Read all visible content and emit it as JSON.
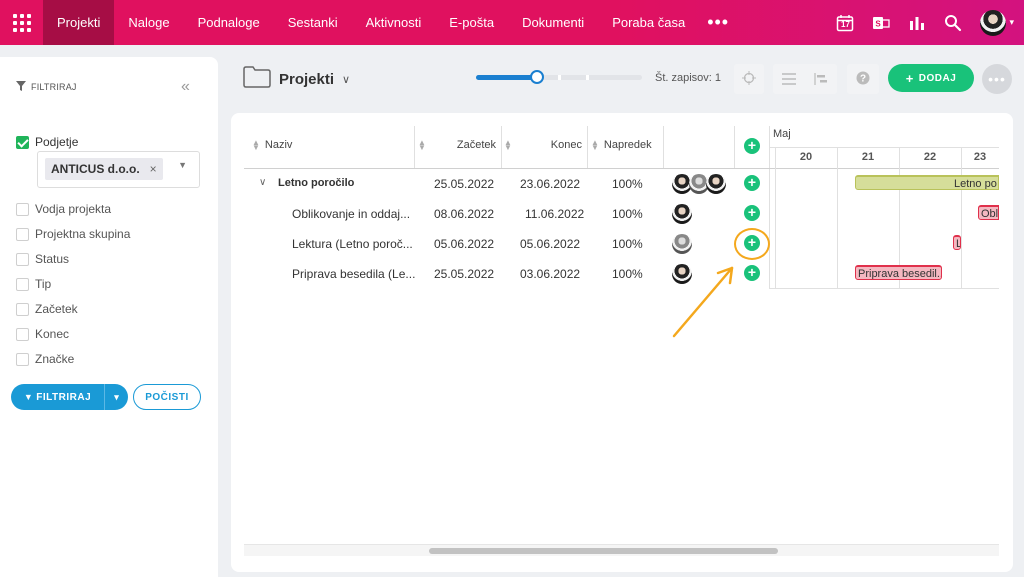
{
  "nav": {
    "items": [
      {
        "label": "Projekti",
        "active": true
      },
      {
        "label": "Naloge",
        "active": false
      },
      {
        "label": "Podnaloge",
        "active": false
      },
      {
        "label": "Sestanki",
        "active": false
      },
      {
        "label": "Aktivnosti",
        "active": false
      },
      {
        "label": "E-pošta",
        "active": false
      },
      {
        "label": "Dokumenti",
        "active": false
      },
      {
        "label": "Poraba časa",
        "active": false
      }
    ],
    "more": "•••",
    "calendar_day": "17",
    "icons": [
      "apps-grid-icon",
      "calendar-icon",
      "outlook-icon",
      "bar-chart-icon",
      "search-icon",
      "user-avatar"
    ]
  },
  "sidebar": {
    "title": "FILTRIRAJ",
    "collapse": "«",
    "client_label": "Podjetje",
    "client_tag": "ANTICUS d.o.o.",
    "client_tag_remove": "×",
    "filters": [
      "Vodja projekta",
      "Projektna skupina",
      "Status",
      "Tip",
      "Začetek",
      "Konec",
      "Značke"
    ],
    "filter_button": "FILTRIRAJ",
    "clear_button": "POČISTI"
  },
  "toolbar": {
    "title": "Projekti",
    "record_count": "Št. zapisov: 1",
    "add_button": "DODAJ",
    "more": "•••",
    "zoom_level": 0.37
  },
  "table": {
    "columns": [
      "Naziv",
      "Začetek",
      "Konec",
      "Napredek"
    ],
    "rows": [
      {
        "name": "Letno poročilo",
        "start": "25.05.2022",
        "end": "23.06.2022",
        "progress": "100%",
        "bold": true,
        "expand": "∨"
      },
      {
        "name": "Oblikovanje in oddaj...",
        "start": "08.06.2022",
        "end": "11.06.2022",
        "progress": "100%",
        "bold": false,
        "expand": ""
      },
      {
        "name": "Lektura (Letno poroč...",
        "start": "05.06.2022",
        "end": "05.06.2022",
        "progress": "100%",
        "bold": false,
        "expand": ""
      },
      {
        "name": "Priprava besedila (Le...",
        "start": "25.05.2022",
        "end": "03.06.2022",
        "progress": "100%",
        "bold": false,
        "expand": ""
      }
    ]
  },
  "gantt": {
    "month": "Maj",
    "days": [
      "20",
      "21",
      "22",
      "23"
    ],
    "bars": [
      {
        "label": "Letno po",
        "color": "#d6de9a",
        "border": "#b9c25a"
      },
      {
        "label": "Obli",
        "color": "#f4b8c1",
        "border": "#e0304b"
      },
      {
        "label": "L",
        "color": "#f4b8c1",
        "border": "#e0304b"
      },
      {
        "label": "Priprava besedil...",
        "color": "#f4b8c1",
        "border": "#e0304b"
      }
    ]
  },
  "colors": {
    "nav": "#e0115f",
    "nav_active": "#a60d45",
    "accent_blue": "#1a9ad6",
    "green": "#19c27a",
    "highlight": "#f4a81d"
  }
}
